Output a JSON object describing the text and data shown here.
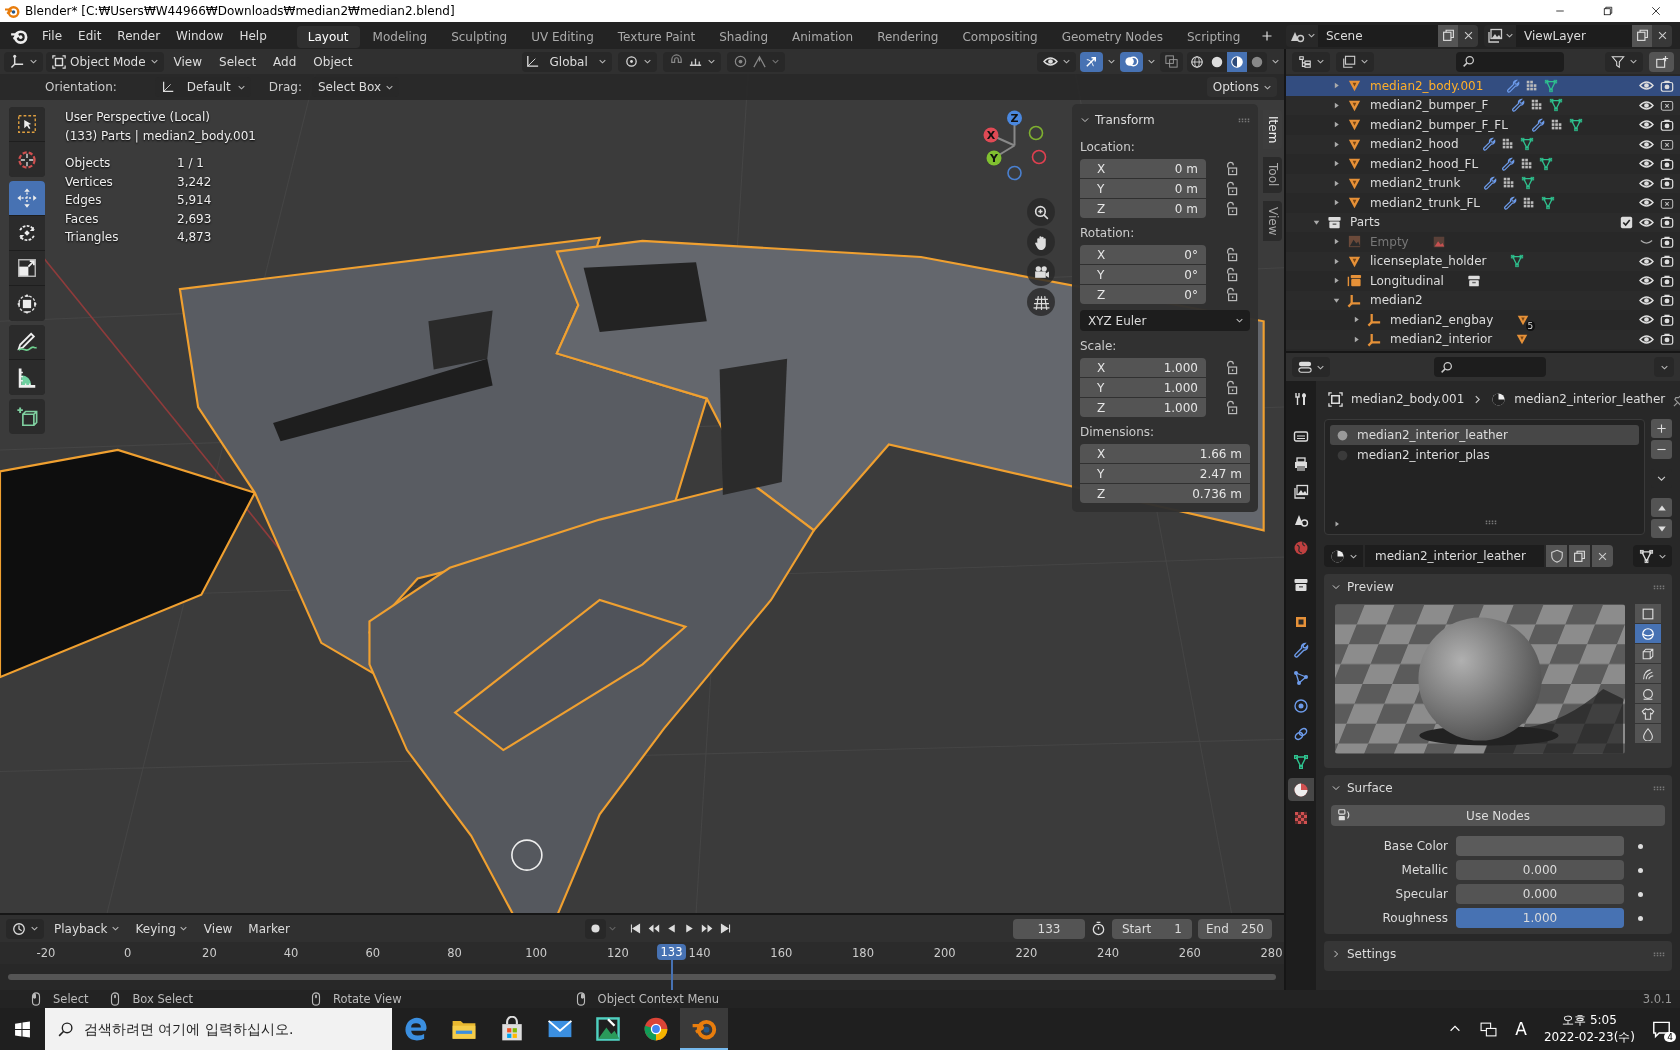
{
  "window": {
    "title": "Blender* [C:₩Users₩W44966₩Downloads₩median2₩median2.blend]"
  },
  "menu": [
    "File",
    "Edit",
    "Render",
    "Window",
    "Help"
  ],
  "workspaces": [
    {
      "label": "Layout",
      "selected": true
    },
    {
      "label": "Modeling",
      "selected": false
    },
    {
      "label": "Sculpting",
      "selected": false
    },
    {
      "label": "UV Editing",
      "selected": false
    },
    {
      "label": "Texture Paint",
      "selected": false
    },
    {
      "label": "Shading",
      "selected": false
    },
    {
      "label": "Animation",
      "selected": false
    },
    {
      "label": "Rendering",
      "selected": false
    },
    {
      "label": "Compositing",
      "selected": false
    },
    {
      "label": "Geometry Nodes",
      "selected": false
    },
    {
      "label": "Scripting",
      "selected": false
    }
  ],
  "scene": {
    "name": "Scene"
  },
  "view_layer": {
    "name": "ViewLayer"
  },
  "viewport_header": {
    "mode": "Object Mode",
    "menus": [
      "View",
      "Select",
      "Add",
      "Object"
    ],
    "orientation": "Global",
    "toggles": [
      {
        "kind": "gizmo",
        "on": true
      },
      {
        "kind": "overlay",
        "on": true
      },
      {
        "kind": "xray",
        "on": false
      }
    ],
    "shading": [
      {
        "kind": "wireframe",
        "selected": false
      },
      {
        "kind": "solid",
        "selected": false
      },
      {
        "kind": "material",
        "selected": true
      },
      {
        "kind": "rendered",
        "selected": false
      }
    ]
  },
  "tool_settings": {
    "orientation_label": "Orientation:",
    "orientation": "Default",
    "drag_label": "Drag:",
    "drag": "Select Box",
    "options": "Options"
  },
  "viewport_info": {
    "view": "User Perspective (Local)",
    "context": "(133) Parts | median2_body.001",
    "stats": [
      {
        "label": "Objects",
        "value": "1 / 1"
      },
      {
        "label": "Vertices",
        "value": "3,242"
      },
      {
        "label": "Edges",
        "value": "5,914"
      },
      {
        "label": "Faces",
        "value": "2,693"
      },
      {
        "label": "Triangles",
        "value": "4,873"
      }
    ]
  },
  "toolbar": {
    "groups": [
      {
        "tools": [
          {
            "kind": "select-box",
            "selected": false
          },
          {
            "kind": "cursor",
            "selected": false
          }
        ]
      },
      {
        "tools": [
          {
            "kind": "move",
            "selected": true
          },
          {
            "kind": "rotate",
            "selected": false
          },
          {
            "kind": "scale",
            "selected": false
          },
          {
            "kind": "transform",
            "selected": false
          }
        ]
      },
      {
        "tools": [
          {
            "kind": "annotate",
            "selected": false
          },
          {
            "kind": "measure",
            "selected": false
          }
        ]
      },
      {
        "tools": [
          {
            "kind": "add-cube",
            "selected": false
          }
        ]
      }
    ]
  },
  "nav_gizmo": {
    "axes": [
      "X",
      "Y",
      "Z"
    ]
  },
  "sidebar": {
    "tabs": [
      {
        "label": "Item",
        "selected": true
      },
      {
        "label": "Tool",
        "selected": false
      },
      {
        "label": "View",
        "selected": false
      }
    ],
    "panel": {
      "title": "Transform",
      "groups": [
        {
          "label": "Location:",
          "kind": "lockable",
          "fields": [
            {
              "axis": "X",
              "value": "0 m"
            },
            {
              "axis": "Y",
              "value": "0 m"
            },
            {
              "axis": "Z",
              "value": "0 m"
            }
          ]
        },
        {
          "label": "Rotation:",
          "kind": "lockable",
          "fields": [
            {
              "axis": "X",
              "value": "0°"
            },
            {
              "axis": "Y",
              "value": "0°"
            },
            {
              "axis": "Z",
              "value": "0°"
            }
          ],
          "mode": "XYZ Euler"
        },
        {
          "label": "Scale:",
          "kind": "lockable",
          "fields": [
            {
              "axis": "X",
              "value": "1.000"
            },
            {
              "axis": "Y",
              "value": "1.000"
            },
            {
              "axis": "Z",
              "value": "1.000"
            }
          ]
        },
        {
          "label": "Dimensions:",
          "kind": "plain",
          "fields": [
            {
              "axis": "X",
              "value": "1.66 m"
            },
            {
              "axis": "Y",
              "value": "2.47 m"
            },
            {
              "axis": "Z",
              "value": "0.736 m"
            }
          ]
        }
      ]
    }
  },
  "outliner": {
    "items": [
      {
        "kind": "group",
        "children": [
          {
            "name": "median2_body.001",
            "kind": "mesh",
            "selected": true,
            "expanded": false,
            "modifiers": true,
            "particles": true,
            "visible": true,
            "renderable": true
          },
          {
            "name": "median2_bumper_F",
            "kind": "mesh",
            "selected": false,
            "expanded": false,
            "modifiers": true,
            "particles": true,
            "visible": true,
            "renderable": false
          },
          {
            "name": "median2_bumper_F_FL",
            "kind": "mesh",
            "selected": false,
            "expanded": false,
            "modifiers": true,
            "particles": true,
            "visible": true,
            "renderable": true
          },
          {
            "name": "median2_hood",
            "kind": "mesh",
            "selected": false,
            "expanded": false,
            "modifiers": true,
            "particles": true,
            "visible": true,
            "renderable": false
          },
          {
            "name": "median2_hood_FL",
            "kind": "mesh",
            "selected": false,
            "expanded": false,
            "modifiers": true,
            "particles": true,
            "visible": true,
            "renderable": true
          },
          {
            "name": "median2_trunk",
            "kind": "mesh",
            "selected": false,
            "expanded": false,
            "modifiers": true,
            "particles": true,
            "visible": true,
            "renderable": true
          },
          {
            "name": "median2_trunk_FL",
            "kind": "mesh",
            "selected": false,
            "expanded": false,
            "modifiers": true,
            "particles": true,
            "visible": true,
            "renderable": false
          }
        ]
      },
      {
        "name": "Parts",
        "kind": "collection",
        "selected": false,
        "expanded": true,
        "checked": true,
        "visible": true,
        "renderable": true,
        "children": [
          {
            "name": "Empty",
            "kind": "image-empty",
            "selected": false,
            "expanded": false,
            "disabled": true,
            "visible": false,
            "renderable": true
          },
          {
            "name": "licenseplate_holder",
            "kind": "mesh",
            "selected": false,
            "expanded": false,
            "modifiers": false,
            "particles": false,
            "visible": true,
            "renderable": true
          },
          {
            "name": "Longitudinal",
            "kind": "instance",
            "selected": false,
            "expanded": false,
            "visible": true,
            "renderable": true
          },
          {
            "name": "median2",
            "kind": "empty",
            "selected": false,
            "expanded": true,
            "visible": true,
            "renderable": true,
            "children": [
              {
                "name": "median2_engbay",
                "kind": "empty-meshes",
                "selected": false,
                "expanded": false,
                "count": "5",
                "visible": true,
                "renderable": true
              },
              {
                "name": "median2_interior",
                "kind": "empty-meshes",
                "selected": false,
                "expanded": false,
                "visible": true,
                "renderable": true
              }
            ]
          }
        ]
      }
    ]
  },
  "properties": {
    "tabs": [
      {
        "kind": "tool",
        "selected": false
      },
      {
        "kind": "render",
        "selected": false
      },
      {
        "kind": "output",
        "selected": false
      },
      {
        "kind": "view-layer",
        "selected": false
      },
      {
        "kind": "scene",
        "selected": false
      },
      {
        "kind": "world",
        "selected": false
      },
      {
        "kind": "collection",
        "selected": false
      },
      {
        "kind": "object",
        "selected": false
      },
      {
        "kind": "modifiers",
        "selected": false
      },
      {
        "kind": "particles",
        "selected": false
      },
      {
        "kind": "physics",
        "selected": false
      },
      {
        "kind": "constraints",
        "selected": false
      },
      {
        "kind": "data",
        "selected": false
      },
      {
        "kind": "material",
        "selected": true
      },
      {
        "kind": "texture",
        "selected": false
      }
    ],
    "breadcrumb": [
      "median2_body.001",
      "median2_interior_leather"
    ],
    "slots": [
      {
        "name": "median2_interior_leather",
        "selected": true
      },
      {
        "name": "median2_interior_plas",
        "selected": false
      }
    ],
    "material": "median2_interior_leather",
    "panels": [
      {
        "kind": "preview",
        "title": "Preview",
        "expanded": true,
        "shapes": [
          {
            "kind": "flat",
            "selected": false
          },
          {
            "kind": "sphere",
            "selected": true
          },
          {
            "kind": "cube",
            "selected": false
          },
          {
            "kind": "hair",
            "selected": false
          },
          {
            "kind": "monkey",
            "selected": false
          },
          {
            "kind": "cloth",
            "selected": false
          },
          {
            "kind": "fluid",
            "selected": false
          }
        ]
      },
      {
        "kind": "surface",
        "title": "Surface",
        "expanded": true,
        "button": "Use Nodes",
        "fields": [
          {
            "label": "Base Color",
            "kind": "color",
            "color": "#5b5b5b"
          },
          {
            "label": "Metallic",
            "kind": "slider",
            "value": "0.000"
          },
          {
            "label": "Specular",
            "kind": "slider",
            "value": "0.000"
          },
          {
            "label": "Roughness",
            "kind": "slider",
            "value": "1.000",
            "level": 1
          }
        ]
      },
      {
        "kind": "settings",
        "title": "Settings",
        "expanded": false
      }
    ]
  },
  "timeline": {
    "menus": [
      {
        "label": "Playback",
        "dropdown": true
      },
      {
        "label": "Keying",
        "dropdown": true
      },
      {
        "label": "View",
        "dropdown": false
      },
      {
        "label": "Marker",
        "dropdown": false
      }
    ],
    "current_frame": "133",
    "start_label": "Start",
    "start": "1",
    "end_label": "End",
    "end": "250",
    "ruler": [
      "-20",
      "0",
      "20",
      "40",
      "60",
      "80",
      "100",
      "120",
      "140",
      "160",
      "180",
      "200",
      "220",
      "240",
      "260",
      "280"
    ],
    "playhead": {
      "label": "133",
      "level": 0.523
    }
  },
  "status_bar": {
    "hints": [
      "Select",
      "Box Select",
      "Rotate View",
      "Object Context Menu"
    ],
    "version": "3.0.1"
  },
  "taskbar": {
    "search_placeholder": "검색하려면 여기에 입력하십시오.",
    "apps": [
      {
        "kind": "browser",
        "selected": false
      },
      {
        "kind": "folder",
        "selected": false
      },
      {
        "kind": "store",
        "selected": false
      },
      {
        "kind": "mail",
        "selected": false
      },
      {
        "kind": "photos",
        "selected": false
      },
      {
        "kind": "chrome",
        "selected": false
      },
      {
        "kind": "blender",
        "selected": true
      }
    ],
    "ime": "A",
    "time": "오후 5:05",
    "date": "2022-02-23(수)",
    "notifications": "4"
  }
}
